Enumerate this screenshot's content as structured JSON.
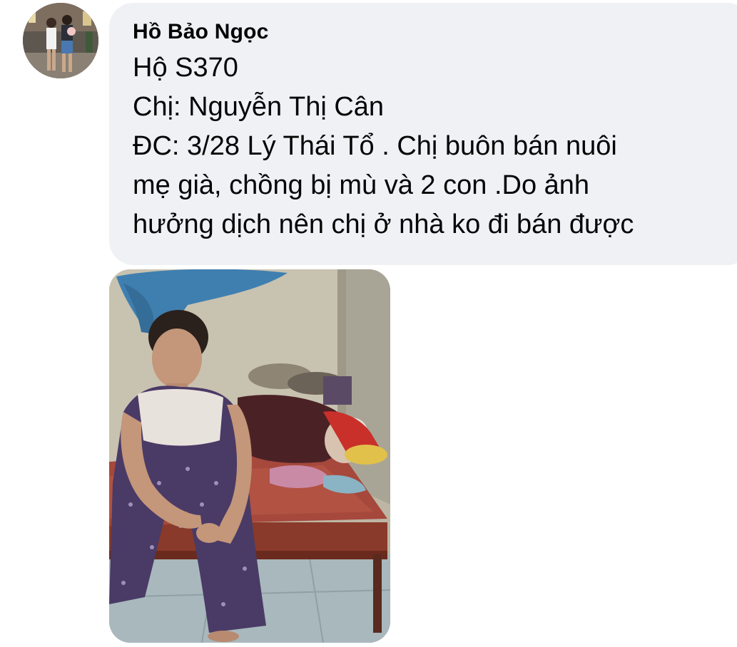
{
  "comment": {
    "author": "Hồ Bảo Ngọc",
    "lines": [
      "Hộ S370",
      "Chị: Nguyễn Thị Cân",
      "ĐC: 3/28 Lý Thái Tổ . Chị buôn bán nuôi",
      "mẹ già, chồng bị mù và 2 con .Do ảnh",
      "hưởng dịch nên chị ở nhà ko đi bán được"
    ]
  },
  "colors": {
    "bubble_bg": "#eff1f5",
    "text": "#050505",
    "page_bg": "#ffffff"
  }
}
